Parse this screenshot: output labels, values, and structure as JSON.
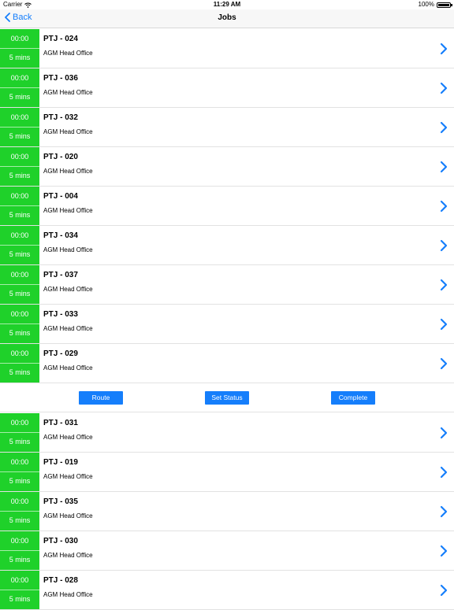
{
  "status_bar": {
    "carrier": "Carrier",
    "time": "11:29 AM",
    "battery": "100%"
  },
  "nav": {
    "back_label": "Back",
    "title": "Jobs"
  },
  "jobs_top": [
    {
      "code": "PTJ - 024",
      "location": "AGM Head Office",
      "start": "00:00",
      "duration": "5 mins"
    },
    {
      "code": "PTJ - 036",
      "location": "AGM Head Office",
      "start": "00:00",
      "duration": "5 mins"
    },
    {
      "code": "PTJ - 032",
      "location": "AGM Head Office",
      "start": "00:00",
      "duration": "5 mins"
    },
    {
      "code": "PTJ - 020",
      "location": "AGM Head Office",
      "start": "00:00",
      "duration": "5 mins"
    },
    {
      "code": "PTJ - 004",
      "location": "AGM Head Office",
      "start": "00:00",
      "duration": "5 mins"
    },
    {
      "code": "PTJ - 034",
      "location": "AGM Head Office",
      "start": "00:00",
      "duration": "5 mins"
    },
    {
      "code": "PTJ - 037",
      "location": "AGM Head Office",
      "start": "00:00",
      "duration": "5 mins"
    },
    {
      "code": "PTJ - 033",
      "location": "AGM Head Office",
      "start": "00:00",
      "duration": "5 mins"
    },
    {
      "code": "PTJ - 029",
      "location": "AGM Head Office",
      "start": "00:00",
      "duration": "5 mins"
    }
  ],
  "actions": {
    "route": "Route",
    "set_status": "Set Status",
    "complete": "Complete"
  },
  "jobs_bottom": [
    {
      "code": "PTJ - 031",
      "location": "AGM Head Office",
      "start": "00:00",
      "duration": "5 mins"
    },
    {
      "code": "PTJ - 019",
      "location": "AGM Head Office",
      "start": "00:00",
      "duration": "5 mins"
    },
    {
      "code": "PTJ - 035",
      "location": "AGM Head Office",
      "start": "00:00",
      "duration": "5 mins"
    },
    {
      "code": "PTJ - 030",
      "location": "AGM Head Office",
      "start": "00:00",
      "duration": "5 mins"
    },
    {
      "code": "PTJ - 028",
      "location": "AGM Head Office",
      "start": "00:00",
      "duration": "5 mins"
    }
  ],
  "colors": {
    "accent": "#157efb",
    "time_block": "#1fd12a"
  },
  "icons": {
    "row_action": "chevron-right-icon",
    "back": "chevron-left-icon",
    "wifi": "wifi-icon",
    "battery": "battery-icon"
  }
}
